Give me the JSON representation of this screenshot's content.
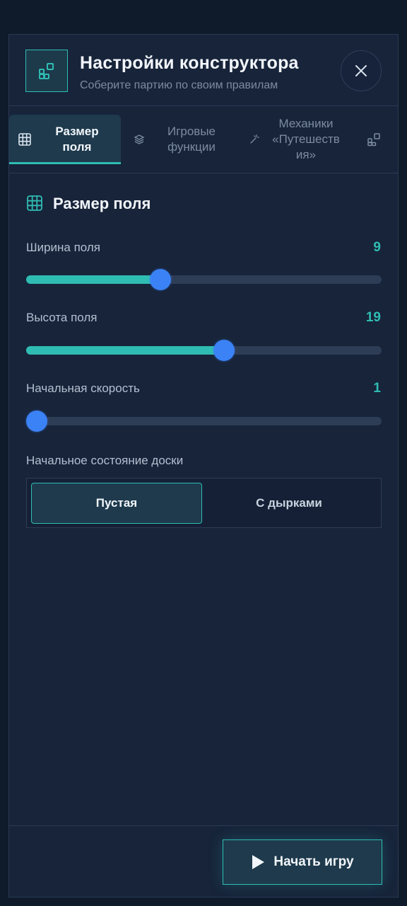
{
  "header": {
    "title": "Настройки конструктора",
    "subtitle": "Соберите партию по своим правилам",
    "icon": "blocks-icon",
    "close_icon": "close-icon"
  },
  "tabs": [
    {
      "label": "Размер\nполя",
      "icon": "grid-icon",
      "active": true
    },
    {
      "label": "Игровые\nфункции",
      "icon": "layers-icon",
      "active": false
    },
    {
      "label": "Механики\n«Путешеств\nия»",
      "icon": "magic-wand-icon",
      "active": false
    },
    {
      "label": "",
      "icon": "blocks-icon",
      "active": false
    }
  ],
  "section": {
    "title": "Размер поля",
    "icon": "grid-icon"
  },
  "sliders": [
    {
      "label": "Ширина поля",
      "value": "9",
      "fraction": 0.37
    },
    {
      "label": "Высота поля",
      "value": "19",
      "fraction": 0.56
    },
    {
      "label": "Начальная скорость",
      "value": "1",
      "fraction": 0.0
    }
  ],
  "board_state": {
    "label": "Начальное состояние доски",
    "options": [
      "Пустая",
      "С дырками"
    ],
    "selected": "Пустая"
  },
  "footer": {
    "start_label": "Начать игру",
    "start_icon": "play-icon"
  },
  "colors": {
    "accent": "#2fbcb2",
    "thumb": "#3b82f6",
    "background": "#0f1a2b",
    "panel": "#17243a"
  }
}
